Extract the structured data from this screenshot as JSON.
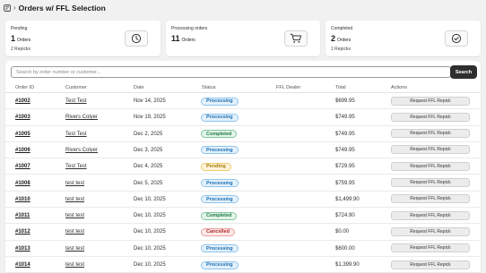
{
  "header": {
    "title": "Orders w/ FFL Selection"
  },
  "cards": [
    {
      "label": "Pending",
      "count": "1",
      "unit": "Orders",
      "sub": "2 Repicks",
      "icon": "clock-icon"
    },
    {
      "label": "Processing orders",
      "count": "11",
      "unit": "Orders",
      "sub": "",
      "icon": "cart-icon"
    },
    {
      "label": "Completed",
      "count": "2",
      "unit": "Orders",
      "sub": "1 Repicks",
      "icon": "check-circle-icon"
    }
  ],
  "search": {
    "placeholder": "Search by order number or customer...",
    "button": "Search"
  },
  "table": {
    "columns": [
      "Order ID",
      "Customer",
      "Date",
      "Status",
      "FFL Dealer",
      "Total",
      "Actions"
    ],
    "rows": [
      {
        "id": "#1002",
        "customer": "Test Test",
        "date": "Nov 14, 2025",
        "status": "Processing",
        "dealer": "",
        "total": "$699.95",
        "action": "Request FFL Repick"
      },
      {
        "id": "#1003",
        "customer": "Rivers Colyer",
        "date": "Nov 19, 2025",
        "status": "Processing",
        "dealer": "",
        "total": "$749.95",
        "action": "Request FFL Repick"
      },
      {
        "id": "#1005",
        "customer": "Test Test",
        "date": "Dec 2, 2025",
        "status": "Completed",
        "dealer": "",
        "total": "$749.95",
        "action": "Request FFL Repick"
      },
      {
        "id": "#1006",
        "customer": "Rivers Colyer",
        "date": "Dec 3, 2025",
        "status": "Processing",
        "dealer": "",
        "total": "$749.95",
        "action": "Request FFL Repick"
      },
      {
        "id": "#1007",
        "customer": "Test Test",
        "date": "Dec 4, 2025",
        "status": "Pending",
        "dealer": "",
        "total": "$729.95",
        "action": "Request FFL Repick"
      },
      {
        "id": "#1008",
        "customer": "test test",
        "date": "Dec 5, 2025",
        "status": "Processing",
        "dealer": "",
        "total": "$759.95",
        "action": "Request FFL Repick"
      },
      {
        "id": "#1010",
        "customer": "test test",
        "date": "Dec 10, 2025",
        "status": "Processing",
        "dealer": "",
        "total": "$1,499.90",
        "action": "Request FFL Repick"
      },
      {
        "id": "#1011",
        "customer": "test test",
        "date": "Dec 10, 2025",
        "status": "Completed",
        "dealer": "",
        "total": "$724.90",
        "action": "Request FFL Repick"
      },
      {
        "id": "#1012",
        "customer": "test test",
        "date": "Dec 10, 2025",
        "status": "Cancelled",
        "dealer": "",
        "total": "$0.00",
        "action": "Request FFL Repick"
      },
      {
        "id": "#1013",
        "customer": "test test",
        "date": "Dec 10, 2025",
        "status": "Processing",
        "dealer": "",
        "total": "$600.00",
        "action": "Request FFL Repick"
      },
      {
        "id": "#1014",
        "customer": "test test",
        "date": "Dec 10, 2025",
        "status": "Processing",
        "dealer": "",
        "total": "$1,399.90",
        "action": "Request FFL Repick"
      }
    ]
  }
}
